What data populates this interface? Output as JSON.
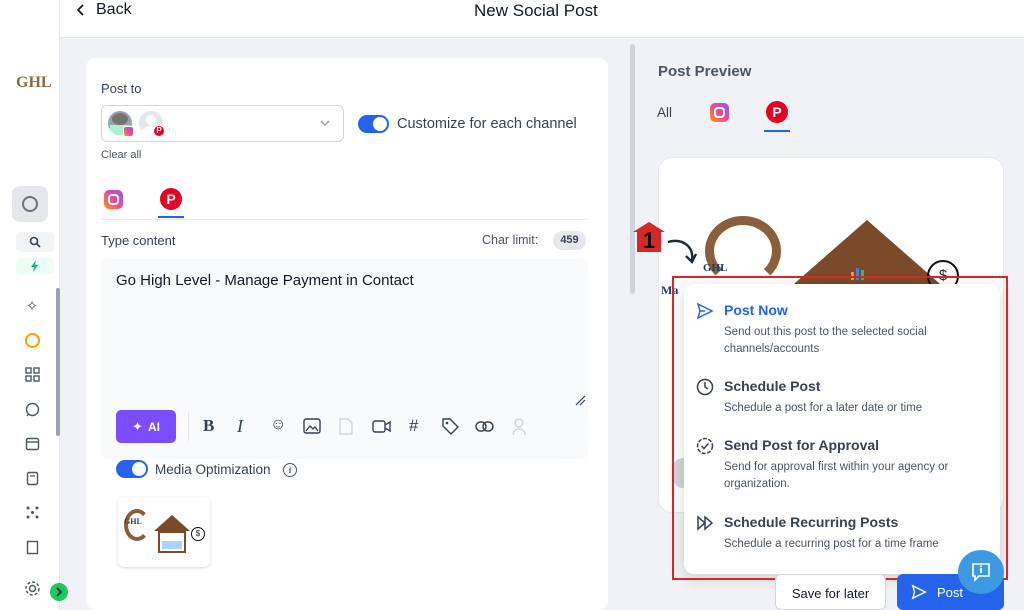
{
  "header": {
    "back_label": "Back",
    "title": "New Social Post"
  },
  "sidebar": {
    "logo": "GHL"
  },
  "compose": {
    "post_to_label": "Post to",
    "clear_all": "Clear all",
    "customize_label": "Customize for each channel",
    "type_content_label": "Type content",
    "char_limit_label": "Char limit:",
    "char_limit_value": "459",
    "content_text": "Go High Level - Manage Payment in Contact",
    "ai_label": "AI",
    "media_optimization_label": "Media Optimization",
    "thumb_logo": "GHL"
  },
  "preview": {
    "title": "Post Preview",
    "tab_all": "All",
    "preview_logo": "GHL",
    "preview_fragment": "Ma"
  },
  "annotation": {
    "number": "1"
  },
  "menu": {
    "post_now": {
      "title": "Post Now",
      "desc": "Send out this post to the selected social channels/accounts"
    },
    "schedule": {
      "title": "Schedule Post",
      "desc": "Schedule a post for a later date or time"
    },
    "approval": {
      "title": "Send Post for Approval",
      "desc": "Send for approval first within your agency or organization."
    },
    "recurring": {
      "title": "Schedule Recurring Posts",
      "desc": "Schedule a recurring post for a time frame"
    }
  },
  "footer": {
    "save_later": "Save for later",
    "post": "Post"
  },
  "colors": {
    "accent": "#2563eb",
    "ai_purple": "#7c4dff",
    "pinterest": "#e60023",
    "annotation_red": "#d42828"
  }
}
